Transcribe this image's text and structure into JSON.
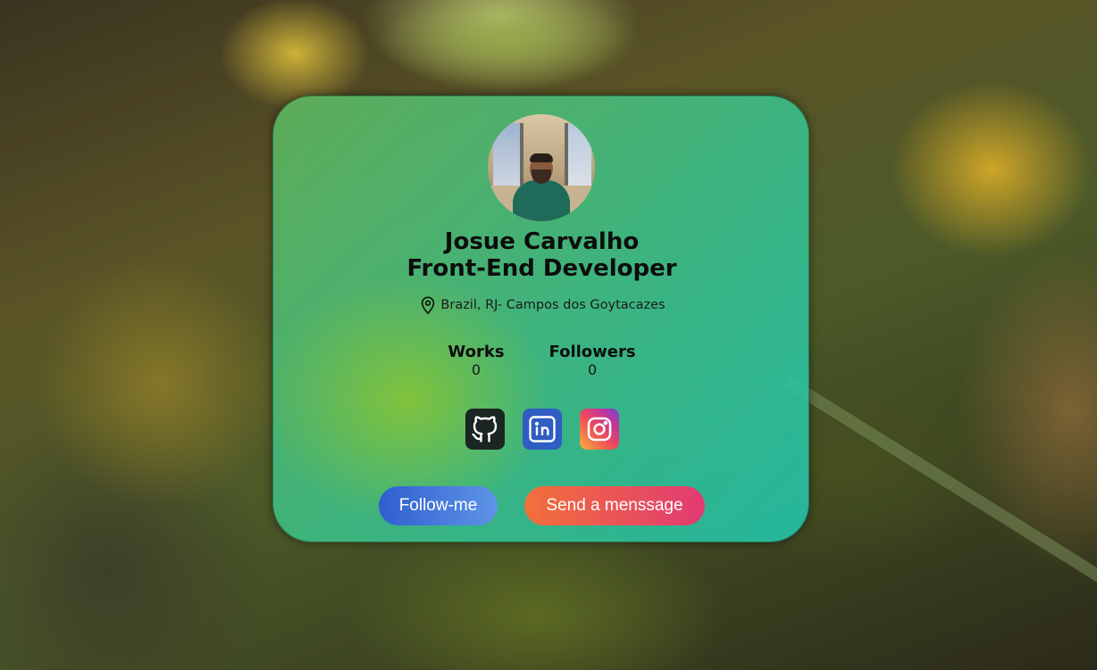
{
  "profile": {
    "name": "Josue Carvalho",
    "role": "Front-End Developer",
    "location": "Brazil, RJ- Campos dos Goytacazes",
    "avatar_icon": "profile-photo"
  },
  "stats": [
    {
      "label": "Works",
      "value": "0"
    },
    {
      "label": "Followers",
      "value": "0"
    }
  ],
  "socials": [
    {
      "icon": "github-icon",
      "color": "#1b2521"
    },
    {
      "icon": "linkedin-icon",
      "color": "#2f5dc2"
    },
    {
      "icon": "instagram-icon",
      "color": "#e1306c"
    }
  ],
  "actions": {
    "follow_label": "Follow-me",
    "message_label": "Send a menssage"
  },
  "colors": {
    "card_tint": "#3cc38c",
    "follow_button": "#2f5fd0",
    "message_button": "#e23a73"
  }
}
